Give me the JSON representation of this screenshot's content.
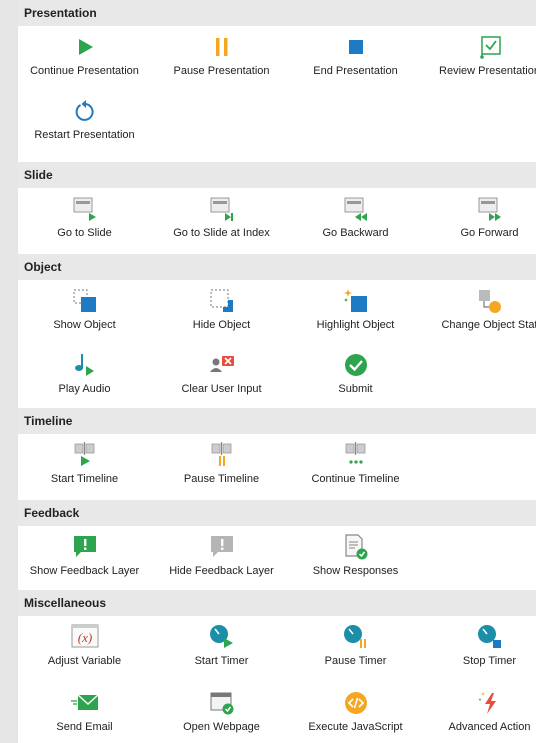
{
  "sections": {
    "presentation": {
      "title": "Presentation",
      "items": [
        {
          "label": "Continue Presentation",
          "icon": "play-icon"
        },
        {
          "label": "Pause Presentation",
          "icon": "pause-icon"
        },
        {
          "label": "End Presentation",
          "icon": "stop-icon"
        },
        {
          "label": "Review Presentation",
          "icon": "review-icon"
        },
        {
          "label": "Restart Presentation",
          "icon": "restart-icon"
        }
      ]
    },
    "slide": {
      "title": "Slide",
      "items": [
        {
          "label": "Go to Slide",
          "icon": "go-to-slide-icon"
        },
        {
          "label": "Go to Slide at Index",
          "icon": "go-to-slide-index-icon"
        },
        {
          "label": "Go Backward",
          "icon": "go-backward-icon"
        },
        {
          "label": "Go Forward",
          "icon": "go-forward-icon"
        }
      ]
    },
    "object": {
      "title": "Object",
      "items": [
        {
          "label": "Show Object",
          "icon": "show-object-icon"
        },
        {
          "label": "Hide Object",
          "icon": "hide-object-icon"
        },
        {
          "label": "Highlight Object",
          "icon": "highlight-object-icon"
        },
        {
          "label": "Change Object Stat",
          "icon": "change-object-state-icon"
        },
        {
          "label": "Play Audio",
          "icon": "play-audio-icon"
        },
        {
          "label": "Clear User Input",
          "icon": "clear-input-icon"
        },
        {
          "label": "Submit",
          "icon": "submit-icon"
        }
      ]
    },
    "timeline": {
      "title": "Timeline",
      "items": [
        {
          "label": "Start Timeline",
          "icon": "start-timeline-icon"
        },
        {
          "label": "Pause Timeline",
          "icon": "pause-timeline-icon"
        },
        {
          "label": "Continue Timeline",
          "icon": "continue-timeline-icon"
        }
      ]
    },
    "feedback": {
      "title": "Feedback",
      "items": [
        {
          "label": "Show Feedback Layer",
          "icon": "show-feedback-icon"
        },
        {
          "label": "Hide Feedback Layer",
          "icon": "hide-feedback-icon"
        },
        {
          "label": "Show Responses",
          "icon": "show-responses-icon"
        }
      ]
    },
    "misc": {
      "title": "Miscellaneous",
      "items": [
        {
          "label": "Adjust Variable",
          "icon": "variable-icon"
        },
        {
          "label": "Start Timer",
          "icon": "start-timer-icon"
        },
        {
          "label": "Pause Timer",
          "icon": "pause-timer-icon"
        },
        {
          "label": "Stop Timer",
          "icon": "stop-timer-icon"
        },
        {
          "label": "Send Email",
          "icon": "email-icon"
        },
        {
          "label": "Open Webpage",
          "icon": "webpage-icon"
        },
        {
          "label": "Execute JavaScript",
          "icon": "javascript-icon"
        },
        {
          "label": "Advanced Action",
          "icon": "advanced-action-icon"
        }
      ]
    }
  },
  "colors": {
    "green": "#2ea44f",
    "orange": "#f5a623",
    "blue": "#1f7ac4",
    "teal": "#1b8fa8",
    "red": "#e84c3d",
    "gray": "#9a9a9a",
    "header_bg": "#e8e8e8"
  }
}
